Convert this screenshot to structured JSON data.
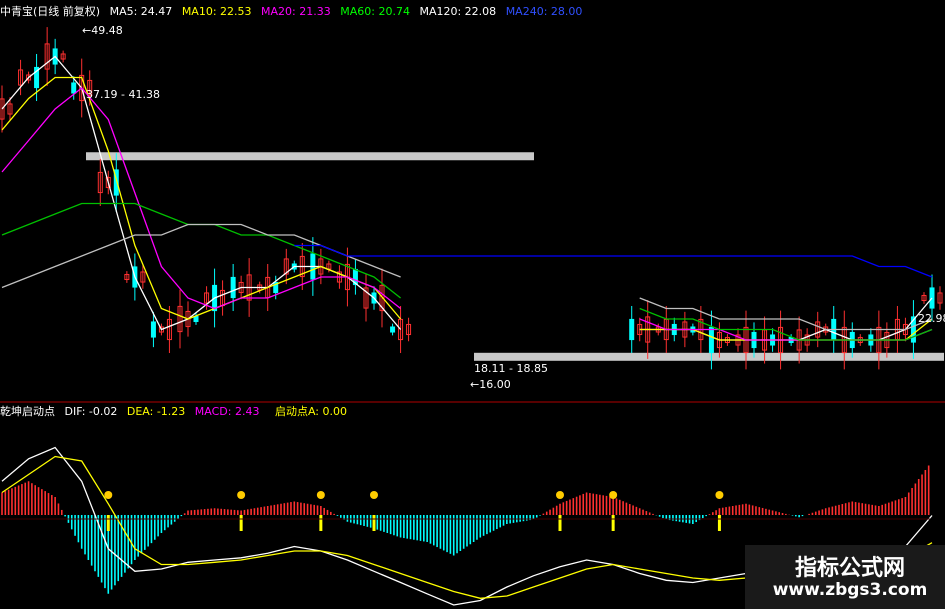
{
  "header": {
    "name": "中青宝(日线 前复权)",
    "ma5": "MA5: 24.47",
    "ma10": "MA10: 22.53",
    "ma20": "MA20: 21.33",
    "ma60": "MA60: 20.74",
    "ma120": "MA120: 22.08",
    "ma240": "MA240: 28.00"
  },
  "indicator": {
    "name": "乾坤启动点",
    "dif": "DIF: -0.02",
    "dea": "DEA: -1.23",
    "macd": "MACD: 2.43",
    "qidong": "启动点A: 0.00"
  },
  "annotations": {
    "high": "49.48",
    "range1": "37.19 - 41.38",
    "range2": "18.11 - 18.85",
    "low": "16.00",
    "right": "22.98"
  },
  "watermark": {
    "title": "指标公式网",
    "url": "www.zbgs3.com"
  },
  "colors": {
    "background": "#000000",
    "up": "#ff3030",
    "down": "#00ffff",
    "ma5": "#ffffff",
    "ma10": "#ffff00",
    "ma20": "#ff00ff",
    "ma60": "#00c000",
    "ma120": "#c0c0c0",
    "ma240": "#0000ff",
    "dif": "#ffffff",
    "dea": "#ffff00",
    "band": "#c8c8c8"
  },
  "chart_data": [
    {
      "type": "line",
      "title": "中青宝(日线 前复权)",
      "notes": "candlestick price chart with moving averages; values approximate",
      "ylim": [
        16,
        50
      ],
      "x": [
        0,
        10,
        20,
        30,
        40,
        50,
        60,
        70,
        80,
        90,
        100,
        110,
        120,
        130,
        140,
        150,
        160,
        170,
        180,
        190,
        200,
        210,
        220,
        230,
        240,
        250,
        260,
        270,
        280,
        290,
        300,
        310,
        320,
        330,
        340,
        350
      ],
      "series": [
        {
          "name": "MA5",
          "values": [
            42,
            45,
            47,
            44,
            35,
            26,
            21,
            22,
            24,
            25,
            25,
            27,
            27,
            26,
            24,
            21,
            null,
            null,
            null,
            null,
            null,
            null,
            null,
            null,
            21,
            21,
            21,
            20,
            20,
            20,
            20,
            21,
            20,
            20,
            21,
            24
          ]
        },
        {
          "name": "MA10",
          "values": [
            40,
            43,
            45,
            45,
            38,
            29,
            23,
            22,
            23,
            24,
            25,
            26,
            27,
            26,
            25,
            22,
            null,
            null,
            null,
            null,
            null,
            null,
            null,
            null,
            21,
            21,
            21,
            20,
            20,
            20,
            20,
            20,
            20,
            20,
            20,
            22
          ]
        },
        {
          "name": "MA20",
          "values": [
            36,
            39,
            42,
            44,
            41,
            34,
            27,
            24,
            23,
            24,
            24,
            25,
            26,
            26,
            25,
            23,
            null,
            null,
            null,
            null,
            null,
            null,
            null,
            null,
            22,
            21,
            21,
            21,
            20,
            20,
            20,
            20,
            20,
            20,
            20,
            21
          ]
        },
        {
          "name": "MA60",
          "values": [
            30,
            31,
            32,
            33,
            33,
            33,
            32,
            31,
            31,
            30,
            30,
            29,
            28,
            27,
            26,
            24,
            null,
            null,
            null,
            null,
            null,
            null,
            null,
            null,
            23,
            22,
            22,
            21,
            21,
            21,
            20,
            20,
            20,
            20,
            20,
            21
          ]
        },
        {
          "name": "MA120",
          "values": [
            25,
            26,
            27,
            28,
            29,
            30,
            30,
            31,
            31,
            31,
            30,
            30,
            29,
            28,
            27,
            26,
            null,
            null,
            null,
            null,
            null,
            null,
            null,
            null,
            24,
            23,
            23,
            22,
            22,
            22,
            22,
            21,
            21,
            21,
            21,
            22
          ]
        },
        {
          "name": "MA240",
          "values": [
            null,
            null,
            null,
            null,
            null,
            null,
            null,
            null,
            null,
            null,
            null,
            29,
            29,
            28,
            28,
            28,
            28,
            28,
            28,
            28,
            28,
            28,
            28,
            28,
            28,
            28,
            28,
            28,
            28,
            28,
            28,
            28,
            28,
            27,
            27,
            26
          ]
        }
      ]
    },
    {
      "type": "bar",
      "title": "乾坤启动点",
      "notes": "MACD histogram with DIF/DEA lines; values approximate",
      "ylim": [
        -4,
        4
      ],
      "x": [
        0,
        10,
        20,
        30,
        40,
        50,
        60,
        70,
        80,
        90,
        100,
        110,
        120,
        130,
        140,
        150,
        160,
        170,
        180,
        190,
        200,
        210,
        220,
        230,
        240,
        250,
        260,
        270,
        280,
        290,
        300,
        310,
        320,
        330,
        340,
        350
      ],
      "series": [
        {
          "name": "MACD",
          "values": [
            1.0,
            1.5,
            0.8,
            -1.5,
            -3.5,
            -2.0,
            -0.8,
            0.2,
            0.3,
            0.2,
            0.4,
            0.6,
            0.4,
            -0.3,
            -0.6,
            -1.0,
            -1.2,
            -1.8,
            -1.0,
            -0.4,
            -0.2,
            0.5,
            1.0,
            0.8,
            0.3,
            -0.2,
            -0.4,
            0.3,
            0.5,
            0.2,
            -0.1,
            0.3,
            0.6,
            0.4,
            0.8,
            2.4
          ]
        },
        {
          "name": "DIF",
          "values": [
            1.5,
            2.5,
            3.0,
            1.5,
            -1.5,
            -2.5,
            -2.4,
            -2.1,
            -2.0,
            -1.9,
            -1.7,
            -1.4,
            -1.6,
            -2.0,
            -2.5,
            -3.0,
            -3.5,
            -4.0,
            -3.8,
            -3.2,
            -2.7,
            -2.3,
            -2.0,
            -2.2,
            -2.6,
            -2.9,
            -3.0,
            -2.8,
            -2.6,
            -2.5,
            -2.6,
            -2.4,
            -2.2,
            -2.0,
            -1.4,
            -0.02
          ]
        },
        {
          "name": "DEA",
          "values": [
            1.0,
            1.8,
            2.6,
            2.4,
            0.5,
            -1.5,
            -2.2,
            -2.2,
            -2.1,
            -2.0,
            -1.8,
            -1.6,
            -1.6,
            -1.8,
            -2.2,
            -2.6,
            -3.0,
            -3.4,
            -3.7,
            -3.6,
            -3.2,
            -2.8,
            -2.4,
            -2.2,
            -2.4,
            -2.6,
            -2.8,
            -2.9,
            -2.8,
            -2.7,
            -2.6,
            -2.6,
            -2.5,
            -2.3,
            -1.9,
            -1.23
          ]
        }
      ]
    }
  ]
}
